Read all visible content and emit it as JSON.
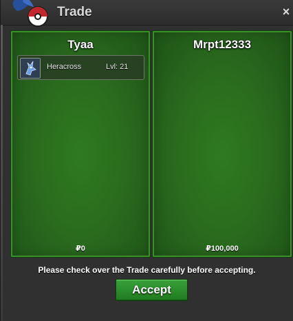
{
  "window": {
    "title": "Trade",
    "close_label": "×"
  },
  "trade": {
    "left": {
      "player": "Tyaa",
      "items": [
        {
          "name": "Heracross",
          "level": "Lvl: 21",
          "icon": "heracross-icon"
        }
      ],
      "money": "₽0"
    },
    "right": {
      "player": "Mrpt12333",
      "items": [],
      "money": "₽100,000"
    }
  },
  "notice": "Please check over the Trade carefully before accepting.",
  "accept_label": "Accept",
  "colors": {
    "panel_green": "#2a6c1e",
    "accept_green": "#2b8a2b",
    "title_text": "#d9d9d9"
  }
}
